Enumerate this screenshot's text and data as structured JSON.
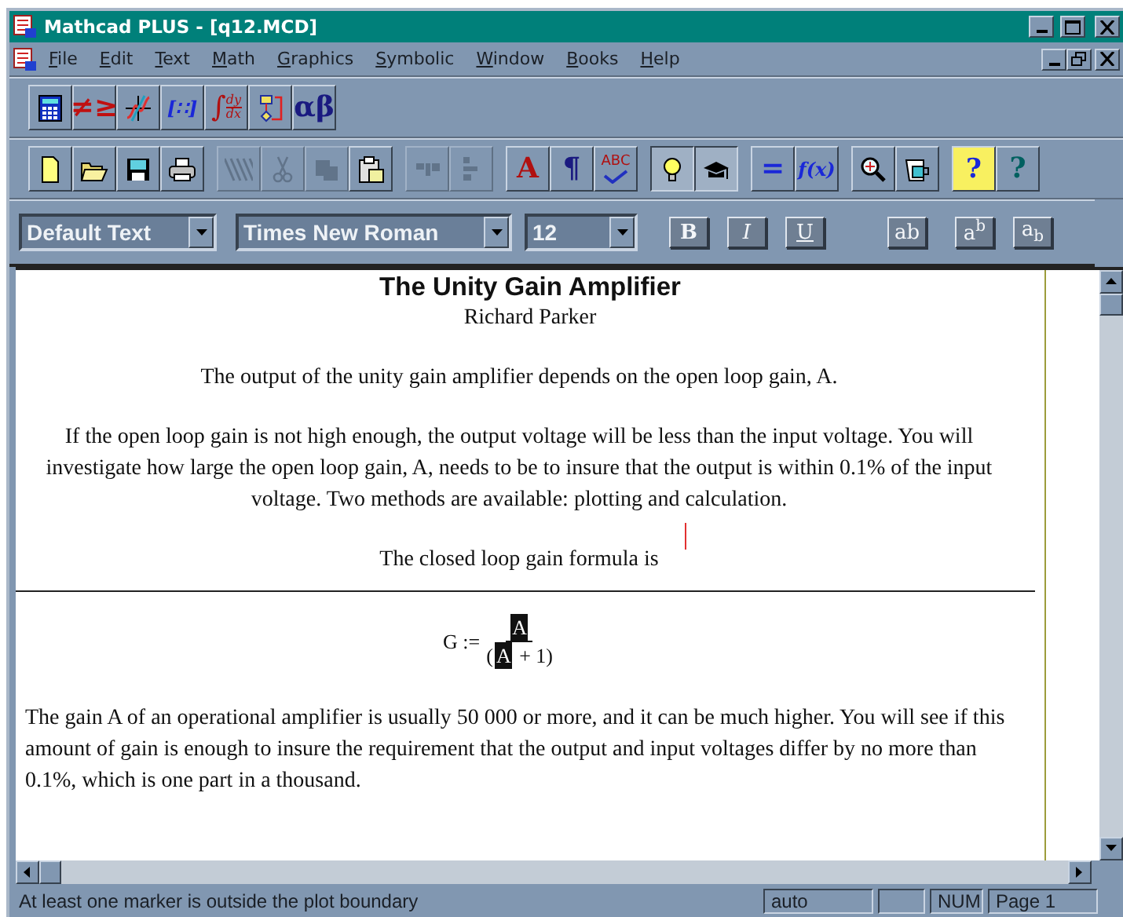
{
  "window": {
    "title": "Mathcad PLUS - [q12.MCD]"
  },
  "menu": [
    {
      "label": "File"
    },
    {
      "label": "Edit"
    },
    {
      "label": "Text"
    },
    {
      "label": "Math"
    },
    {
      "label": "Graphics"
    },
    {
      "label": "Symbolic"
    },
    {
      "label": "Window"
    },
    {
      "label": "Books"
    },
    {
      "label": "Help"
    }
  ],
  "palette_toolbar": [
    {
      "kind": "calculator"
    },
    {
      "kind": "relational",
      "label": "≠≥"
    },
    {
      "kind": "graph"
    },
    {
      "kind": "matrix",
      "label": "[∷]"
    },
    {
      "kind": "calculus",
      "label": "∫",
      "numerator": "dy",
      "denominator": "dx"
    },
    {
      "kind": "program"
    },
    {
      "kind": "greek",
      "label": "αβ"
    }
  ],
  "standard_toolbar": [
    [
      {
        "kind": "new",
        "disabled": false,
        "pressed": false
      },
      {
        "kind": "open",
        "disabled": false,
        "pressed": false
      },
      {
        "kind": "save",
        "disabled": false,
        "pressed": false
      },
      {
        "kind": "print",
        "disabled": false,
        "pressed": false
      }
    ],
    [
      {
        "kind": "cut-region",
        "disabled": true,
        "pressed": false
      },
      {
        "kind": "scissors",
        "disabled": true,
        "pressed": false
      },
      {
        "kind": "copy",
        "disabled": true,
        "pressed": false
      },
      {
        "kind": "paste",
        "disabled": false,
        "pressed": false
      }
    ],
    [
      {
        "kind": "align-across",
        "disabled": true,
        "pressed": false
      },
      {
        "kind": "align-down",
        "disabled": true,
        "pressed": false
      }
    ],
    [
      {
        "kind": "text-style",
        "label": "A",
        "disabled": false,
        "pressed": false
      },
      {
        "kind": "paragraph",
        "label": "¶",
        "disabled": false,
        "pressed": false
      },
      {
        "kind": "spell",
        "label": "ABC",
        "disabled": false,
        "pressed": false
      }
    ],
    [
      {
        "kind": "bulb",
        "disabled": false,
        "pressed": true
      },
      {
        "kind": "cap",
        "disabled": false,
        "pressed": true
      }
    ],
    [
      {
        "kind": "evaluate",
        "label": "=",
        "disabled": false,
        "pressed": false
      },
      {
        "kind": "function",
        "label": "f(x)",
        "disabled": false,
        "pressed": false
      }
    ],
    [
      {
        "kind": "zoom",
        "disabled": false,
        "pressed": false
      },
      {
        "kind": "resource",
        "disabled": false,
        "pressed": false
      }
    ],
    [
      {
        "kind": "note-help",
        "label": "?",
        "disabled": false,
        "pressed": false
      },
      {
        "kind": "help",
        "label": "?",
        "disabled": false,
        "pressed": false
      }
    ]
  ],
  "format_bar": {
    "style": {
      "value": "Default Text",
      "disabled": true
    },
    "font": {
      "value": "Times New Roman",
      "disabled": true
    },
    "size": {
      "value": "12",
      "disabled": true
    },
    "buttons": [
      {
        "label": "B",
        "kind": "bold"
      },
      {
        "label": "I",
        "kind": "italic"
      },
      {
        "label": "U",
        "kind": "underline"
      },
      {
        "label": "ab",
        "kind": "plain"
      },
      {
        "label": "a$^{b}$",
        "kind": "superscript"
      },
      {
        "label": "a$_{b}$",
        "kind": "subscript"
      }
    ]
  },
  "document": {
    "title": "The Unity Gain Amplifier",
    "author": "Richard Parker",
    "paragraphs_top": [
      "The output of the unity gain amplifier depends on the open loop gain, A.",
      "If the open loop gain is not high enough, the output voltage will be less than the input voltage.  You will investigate how large the open loop gain, A, needs to be to insure that the output is within 0.1% of the input voltage.  Two methods are available:  plotting and calculation.",
      "The closed loop gain formula is"
    ],
    "formula": {
      "lhs": "G :=",
      "numerator": [
        {
          "text": "A",
          "highlighted": true
        }
      ],
      "denominator": [
        {
          "text": "(",
          "highlighted": false
        },
        {
          "text": "A",
          "highlighted": true
        },
        {
          "text": " + 1)",
          "highlighted": false
        }
      ]
    },
    "paragraphs_bottom": [
      "The gain A of an operational amplifier is usually 50 000 or more, and it can be much higher. You will see if this amount of gain is enough to insure the requirement that the output and input voltages differ by no more than 0.1%, which is one part in a thousand."
    ]
  },
  "status_bar": {
    "message": "At least one marker is outside the  plot boundary",
    "mode": "auto",
    "num": "NUM",
    "page": "Page 1"
  }
}
